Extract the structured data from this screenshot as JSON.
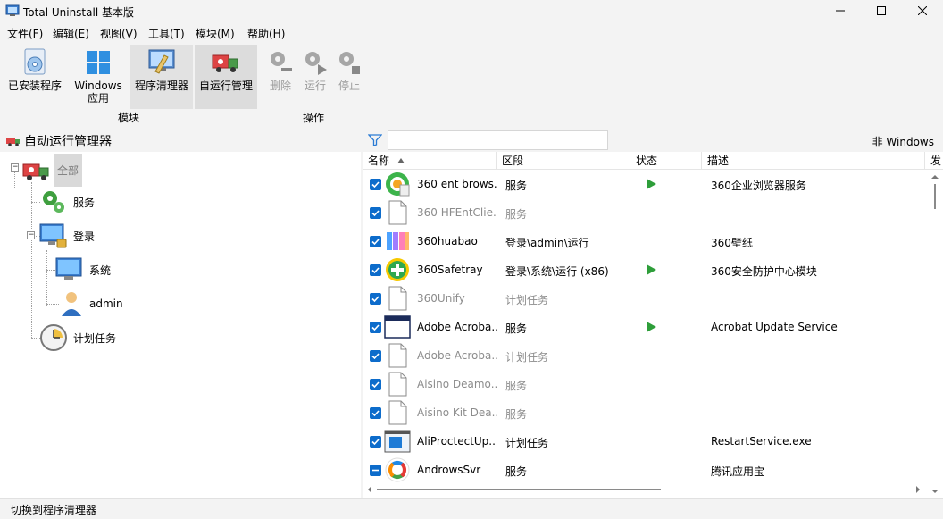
{
  "window": {
    "title": "Total Uninstall 基本版"
  },
  "menu": [
    "文件(F)",
    "编辑(E)",
    "视图(V)",
    "工具(T)",
    "模块(M)",
    "帮助(H)"
  ],
  "toolbar": {
    "installed": "已安装程序",
    "windows_apps_line1": "Windows",
    "windows_apps_line2": "应用",
    "cleaner": "程序清理器",
    "autorun": "自运行管理",
    "delete": "删除",
    "run": "运行",
    "stop": "停止",
    "group_modules": "模块",
    "group_actions": "操作"
  },
  "left": {
    "title": "自动运行管理器",
    "tree": {
      "all": "全部",
      "services": "服务",
      "logon": "登录",
      "system": "系统",
      "admin": "admin",
      "tasks": "计划任务"
    }
  },
  "filter": {
    "placeholder": "",
    "non_windows": "非 Windows"
  },
  "table": {
    "headers": [
      "名称",
      "区段",
      "状态",
      "描述",
      "发"
    ],
    "rows": [
      {
        "name": "360 ent brows...",
        "segment": "服务",
        "running": true,
        "desc": "360企业浏览器服务",
        "icon": "browser-360-icon",
        "dim": false,
        "check": "checked"
      },
      {
        "name": "360 HFEntClie...",
        "segment": "服务",
        "running": false,
        "desc": "",
        "icon": "file-icon",
        "dim": true,
        "check": "checked"
      },
      {
        "name": "360huabao",
        "segment": "登录\\admin\\运行",
        "running": false,
        "desc": "360壁纸",
        "icon": "wallpaper-icon",
        "dim": false,
        "check": "checked"
      },
      {
        "name": "360Safetray",
        "segment": "登录\\系统\\运行 (x86)",
        "running": true,
        "desc": "360安全防护中心模块",
        "icon": "safe-360-icon",
        "dim": false,
        "check": "checked"
      },
      {
        "name": "360Unify",
        "segment": "计划任务",
        "running": false,
        "desc": "",
        "icon": "file-icon",
        "dim": true,
        "check": "checked"
      },
      {
        "name": "Adobe Acroba...",
        "segment": "服务",
        "running": true,
        "desc": "Acrobat Update Service",
        "icon": "window-icon",
        "dim": false,
        "check": "checked"
      },
      {
        "name": "Adobe Acroba...",
        "segment": "计划任务",
        "running": false,
        "desc": "",
        "icon": "file-icon",
        "dim": true,
        "check": "checked"
      },
      {
        "name": "Aisino Deamo...",
        "segment": "服务",
        "running": false,
        "desc": "",
        "icon": "file-icon",
        "dim": true,
        "check": "checked"
      },
      {
        "name": "Aisino Kit Dea...",
        "segment": "服务",
        "running": false,
        "desc": "",
        "icon": "file-icon",
        "dim": true,
        "check": "checked"
      },
      {
        "name": "AliProctectUp...",
        "segment": "计划任务",
        "running": false,
        "desc": "RestartService.exe",
        "icon": "app-window-icon",
        "dim": false,
        "check": "checked"
      },
      {
        "name": "AndrowsSvr",
        "segment": "服务",
        "running": false,
        "desc": "腾讯应用宝",
        "icon": "tencent-appstore-icon",
        "dim": false,
        "check": "partial"
      }
    ]
  },
  "statusbar": {
    "text": "切换到程序清理器"
  }
}
